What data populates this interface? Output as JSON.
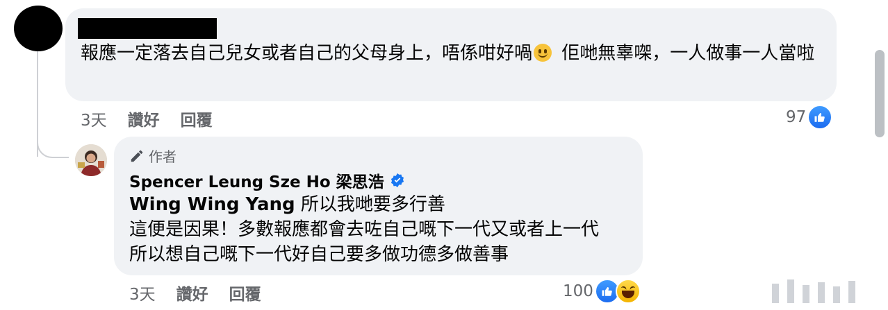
{
  "comment": {
    "text_part1": "報應一定落去自己兒女或者自己的父母身上，唔係咁好喎",
    "emoji": "slightly-smiling-face",
    "text_part2": " 佢哋無辜㗎，一人做事一人當啦",
    "time": "3天",
    "like_label": "讚好",
    "reply_label": "回覆",
    "reaction_count": "97"
  },
  "reply": {
    "author_badge": "作者",
    "name": "Spencer Leung Sze Ho 梁思浩",
    "mention": "Wing Wing Yang",
    "line1_text": " 所以我哋要多行善",
    "line2": "這便是因果！多數報應都會去咗自己嘅下一代又或者上一代",
    "line3": "所以想自己嘅下一代好自己要多做功德多做善事",
    "time": "3天",
    "like_label": "讚好",
    "reply_label": "回覆",
    "reaction_count": "100"
  },
  "colors": {
    "bubble": "#f0f2f5",
    "meta_text": "#65676b",
    "like_blue": "#1877f2",
    "verified_blue": "#1877f2"
  },
  "icons": [
    "pen-icon",
    "verified-badge-icon",
    "like-icon",
    "haha-icon",
    "smile-emoji-icon"
  ]
}
